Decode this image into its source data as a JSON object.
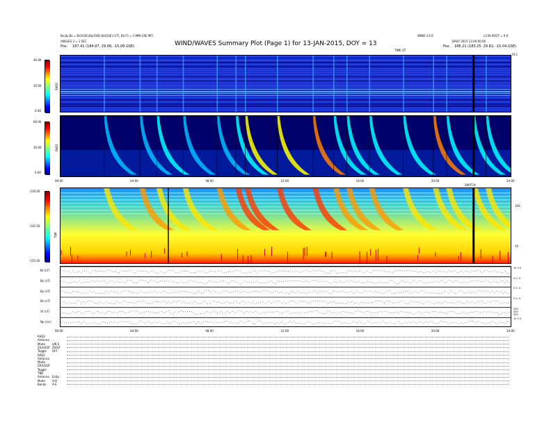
{
  "header": {
    "line1": "Bx,By,Bz = Bx(GSE),By(GSE),Bz(GSE) [nT], B(nT) = 1-MIN GSE MFI",
    "line2": "ANGLES 3 = 1 SEC",
    "pos_left": "Pos:",
    "pos_left_value": "187.41 (184.97, 29.08, -15.08 GSE)",
    "title": "WIND/WAVES Summary Plot (Page 1) for 13-JAN-2015, DOY = 13",
    "right_line1": "WIND 3.4.0",
    "right_line1b": "L3 IN ROOT = 9.0",
    "right_line2": "DAILY 2015 13 00:00:00",
    "pos_right": "Pos:",
    "pos_right_value": "186.21 (183.25, 29.82, -15.04 GSE)",
    "time_axis_label": "TIME UT",
    "doy_label": "013"
  },
  "panels": {
    "rad2": {
      "name": "RAD2",
      "ticks": [
        "40.00",
        "20.00",
        "0.00"
      ],
      "right_ticks": [
        "14",
        "1"
      ]
    },
    "rad1": {
      "name": "RAD1",
      "ticks": [
        "60.00",
        "30.00",
        "0.00"
      ]
    },
    "tnr": {
      "name": "TNR",
      "ticks": [
        "-130.00",
        "-142.50",
        "-155.00"
      ],
      "right_ticks": [
        "100",
        "10"
      ]
    },
    "time_ticks": [
      "00:00",
      "04:00",
      "08:00",
      "12:00",
      "16:00",
      "20:00",
      "24:00"
    ],
    "time_ticks2": [
      "00:00",
      "04:00",
      "08:00",
      "12:00",
      "16:00",
      "20:00",
      "24:00"
    ],
    "marker_label": "SWITCH"
  },
  "traces": [
    {
      "label": "Bt (nT)",
      "right": "10 5 0"
    },
    {
      "label": "Bx (nT)",
      "right": "5 0 -5"
    },
    {
      "label": "By (nT)",
      "right": "5 0 -5"
    },
    {
      "label": "Bz (nT)",
      "right": "5 0 -5"
    },
    {
      "label": "Vt (nT)",
      "right": "500 400 300"
    },
    {
      "label": "Np (/cc)",
      "right": "10 5 0"
    }
  ],
  "mode_table": {
    "rows": [
      {
        "k": "RAD2",
        "v": ""
      },
      {
        "k": "Antenna",
        "v": "..."
      },
      {
        "k": "Mode",
        "v": "LIN S"
      },
      {
        "k": "ZX/LOGP",
        "v": "ZX/LP"
      },
      {
        "k": "Toggle",
        "v": "OFF"
      },
      {
        "k": "RAD1",
        "v": ""
      },
      {
        "k": "Antenna",
        "v": ""
      },
      {
        "k": "Mode",
        "v": ""
      },
      {
        "k": "ZX/LOGP",
        "v": ""
      },
      {
        "k": "Toggle",
        "v": ""
      },
      {
        "k": "TNR",
        "v": ""
      },
      {
        "k": "Antenna",
        "v": "ExSp"
      },
      {
        "k": "Mode",
        "v": "A-D"
      },
      {
        "k": "Bands",
        "v": "A-E"
      }
    ]
  },
  "chart_data": {
    "type": "heatmap",
    "title": "WIND/WAVES Summary Plot (Page 1) for 13-JAN-2015, DOY = 13",
    "xlabel": "TIME UT",
    "x_range": [
      "00:00",
      "24:00"
    ],
    "panels": [
      {
        "name": "RAD2",
        "colorbar_range": [
          0,
          40
        ],
        "colorbar_ticks": [
          40,
          20,
          0
        ]
      },
      {
        "name": "RAD1",
        "colorbar_range": [
          0,
          60
        ],
        "colorbar_ticks": [
          60,
          30,
          0
        ]
      },
      {
        "name": "TNR",
        "colorbar_range": [
          -155,
          -130
        ],
        "colorbar_ticks": [
          -130,
          -142.5,
          -155
        ],
        "freq_ticks": [
          100,
          10
        ]
      }
    ],
    "type_III_bursts_hours": [
      2.3,
      4.2,
      5.1,
      6.5,
      8.3,
      9.3,
      9.8,
      11.5,
      13.4,
      14.5,
      15.2,
      16.4,
      18.2,
      19.8,
      20.5,
      21.9,
      22.6
    ],
    "colormap": [
      "#00008b",
      "#0000ff",
      "#00bfff",
      "#00ffff",
      "#7fff7f",
      "#ffff00",
      "#ff7f00",
      "#ff0000",
      "#8b0000"
    ]
  }
}
